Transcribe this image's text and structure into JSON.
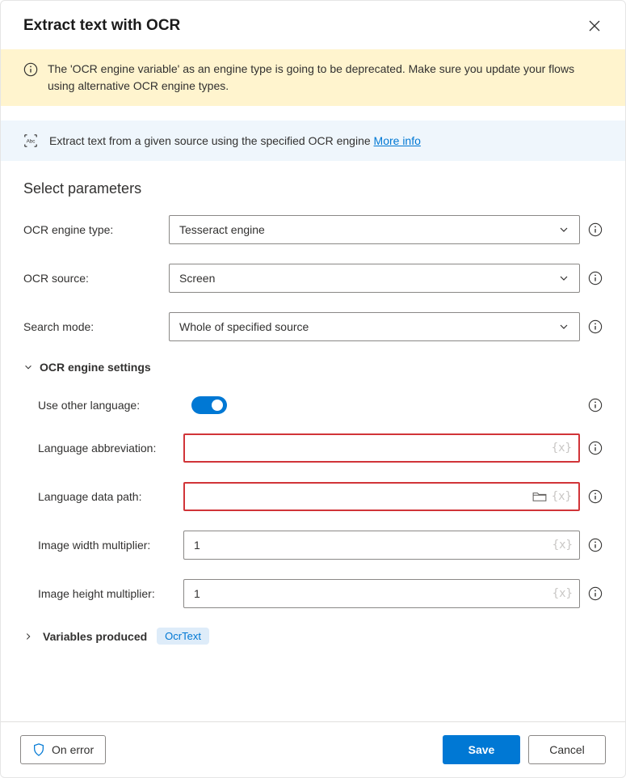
{
  "header": {
    "title": "Extract text with OCR"
  },
  "warning": {
    "text": "The 'OCR engine variable' as an engine type is going to be deprecated.  Make sure you update your flows using alternative OCR engine types."
  },
  "info": {
    "text": "Extract text from a given source using the specified OCR engine ",
    "link_label": "More info"
  },
  "section_title": "Select parameters",
  "fields": {
    "engine_type": {
      "label": "OCR engine type:",
      "value": "Tesseract engine"
    },
    "source": {
      "label": "OCR source:",
      "value": "Screen"
    },
    "search_mode": {
      "label": "Search mode:",
      "value": "Whole of specified source"
    }
  },
  "engine_settings": {
    "title": "OCR engine settings",
    "use_other_language": {
      "label": "Use other language:"
    },
    "lang_abbrev": {
      "label": "Language abbreviation:",
      "value": ""
    },
    "lang_data_path": {
      "label": "Language data path:",
      "value": ""
    },
    "width_mult": {
      "label": "Image width multiplier:",
      "value": "1"
    },
    "height_mult": {
      "label": "Image height multiplier:",
      "value": "1"
    }
  },
  "variables": {
    "title": "Variables produced",
    "pill": "OcrText"
  },
  "footer": {
    "on_error": "On error",
    "save": "Save",
    "cancel": "Cancel"
  }
}
